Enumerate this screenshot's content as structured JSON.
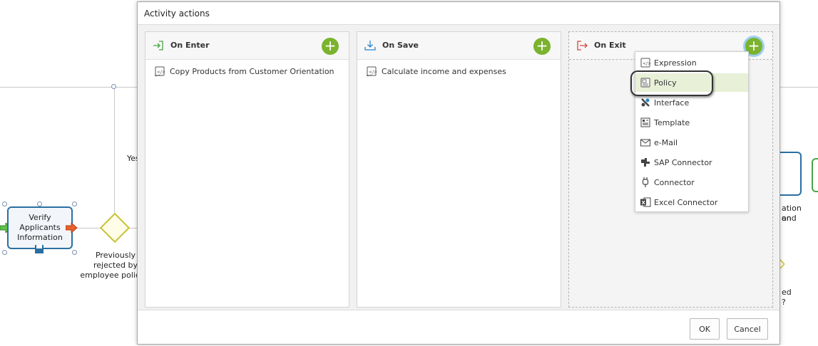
{
  "diagram": {
    "task_label": "Verify Applicants Information",
    "gateway_label": "Previously rejected by employee policies",
    "yes_label": "Yes",
    "right_label_1": "ation and",
    "right_label_2": "on",
    "right_label_3": "ed",
    "right_label_4": "?"
  },
  "dialog": {
    "title": "Activity actions",
    "panels": [
      {
        "title": "On Enter",
        "icon": "enter-icon",
        "items": [
          {
            "label": "Copy Products from Customer Orientation",
            "icon": "expression-icon"
          }
        ]
      },
      {
        "title": "On Save",
        "icon": "save-icon",
        "items": [
          {
            "label": "Calculate income and expenses",
            "icon": "expression-icon"
          }
        ]
      },
      {
        "title": "On Exit",
        "icon": "exit-icon",
        "items": []
      }
    ],
    "menu": [
      {
        "label": "Expression",
        "icon": "expression-icon"
      },
      {
        "label": "Policy",
        "icon": "policy-icon"
      },
      {
        "label": "Interface",
        "icon": "interface-icon"
      },
      {
        "label": "Template",
        "icon": "template-icon"
      },
      {
        "label": "e-Mail",
        "icon": "email-icon"
      },
      {
        "label": "SAP Connector",
        "icon": "sap-connector-icon"
      },
      {
        "label": "Connector",
        "icon": "connector-icon"
      },
      {
        "label": "Excel Connector",
        "icon": "excel-connector-icon"
      }
    ],
    "ok_label": "OK",
    "cancel_label": "Cancel"
  },
  "colors": {
    "add_button": "#7bb32e",
    "task_border": "#2a6fa0",
    "gateway_border": "#c9c23a",
    "menu_hover": "#e8f0d8"
  }
}
